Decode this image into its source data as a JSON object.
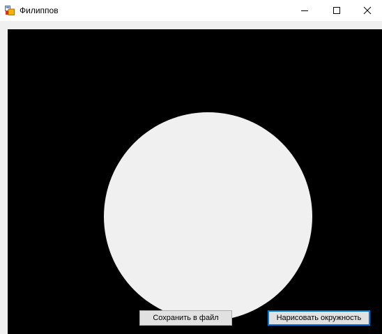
{
  "window": {
    "title": "Филиппов",
    "icon": "winforms-app-icon",
    "controls": [
      "minimize-icon",
      "maximize-icon",
      "close-icon"
    ]
  },
  "canvas": {
    "background": "#000000",
    "circle_fill": "#f0f0f0"
  },
  "buttons": {
    "save_label": "Сохранить в файл",
    "draw_label": "Нарисовать окружность",
    "focus_color": "#0078d7"
  }
}
